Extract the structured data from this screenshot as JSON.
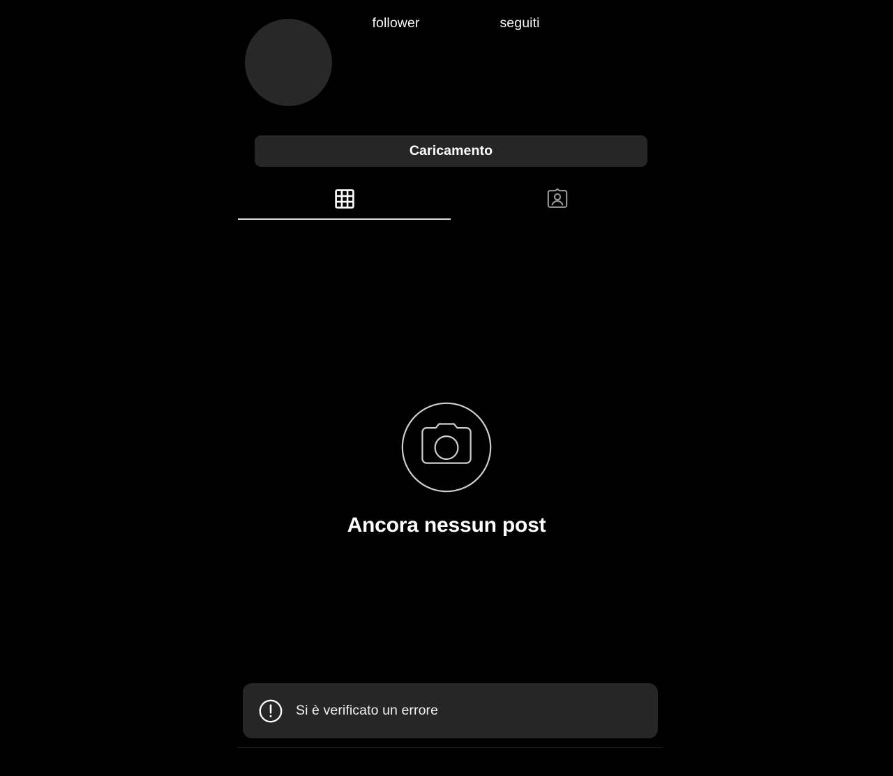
{
  "theme": {
    "background": "#000000",
    "surface": "#262626",
    "avatar_fill": "#282828",
    "text_primary": "#ffffff",
    "text_secondary": "#f2f2f2",
    "icon_active": "#ffffff",
    "icon_inactive": "#8e8e8e",
    "underline": "#dbdbdb",
    "divider": "#232323"
  },
  "profile": {
    "avatar": {
      "icon": "avatar-placeholder",
      "has_image": false
    },
    "stats": [
      {
        "id": "followers",
        "label": "follower",
        "value": ""
      },
      {
        "id": "following",
        "label": "seguiti",
        "value": ""
      }
    ]
  },
  "actions": {
    "primary_button": {
      "label": "Caricamento",
      "state": "loading"
    }
  },
  "tabs": [
    {
      "id": "posts",
      "icon": "grid-icon",
      "label": "",
      "active": true
    },
    {
      "id": "tagged",
      "icon": "tagged-person-icon",
      "label": "",
      "active": false
    }
  ],
  "empty_state": {
    "icon": "camera-circle-icon",
    "title": "Ancora nessun post"
  },
  "toast": {
    "icon": "exclamation-circle-icon",
    "message": "Si è verificato un errore"
  }
}
